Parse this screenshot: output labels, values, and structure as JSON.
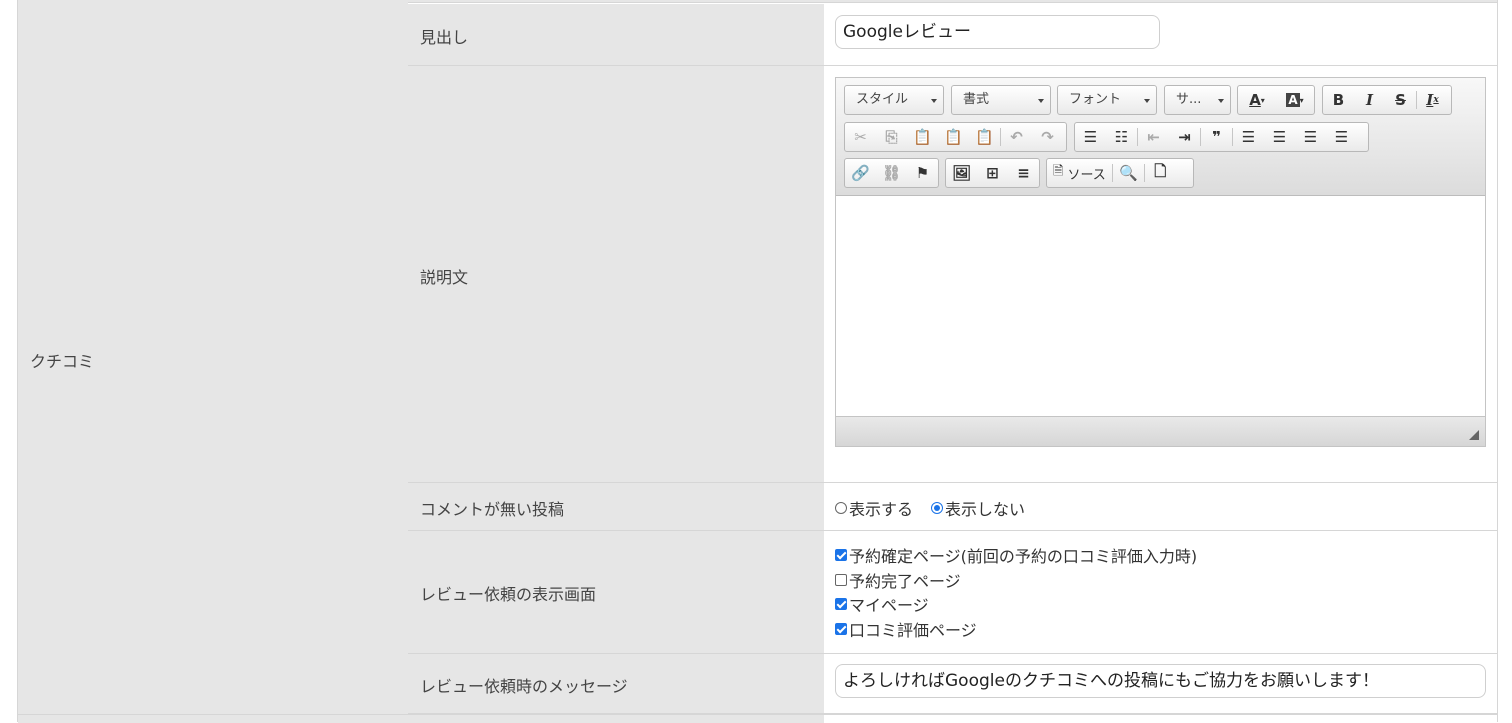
{
  "section": {
    "label": "クチコミ"
  },
  "rows": {
    "heading": {
      "label": "見出し",
      "value": "Googleレビュー"
    },
    "description": {
      "label": "説明文"
    },
    "no_comment": {
      "label": "コメントが無い投稿",
      "options": [
        "表示する",
        "表示しない"
      ],
      "selected": "表示しない"
    },
    "display_screens": {
      "label": "レビュー依頼の表示画面",
      "items": [
        {
          "label": "予約確定ページ(前回の予約の口コミ評価入力時)",
          "checked": true
        },
        {
          "label": "予約完了ページ",
          "checked": false
        },
        {
          "label": "マイページ",
          "checked": true
        },
        {
          "label": "口コミ評価ページ",
          "checked": true
        }
      ]
    },
    "message": {
      "label": "レビュー依頼時のメッセージ",
      "value": "よろしければGoogleのクチコミへの投稿にもご協力をお願いします！"
    }
  },
  "editor": {
    "combos": [
      "スタイル",
      "書式",
      "フォント",
      "サ..."
    ],
    "source_label": "ソース",
    "icons": {
      "text_color": "text-color-icon",
      "bg_color": "background-color-icon",
      "bold": "B",
      "italic": "I",
      "strike": "S",
      "remove_format": "Ix",
      "quote": "❞"
    }
  }
}
